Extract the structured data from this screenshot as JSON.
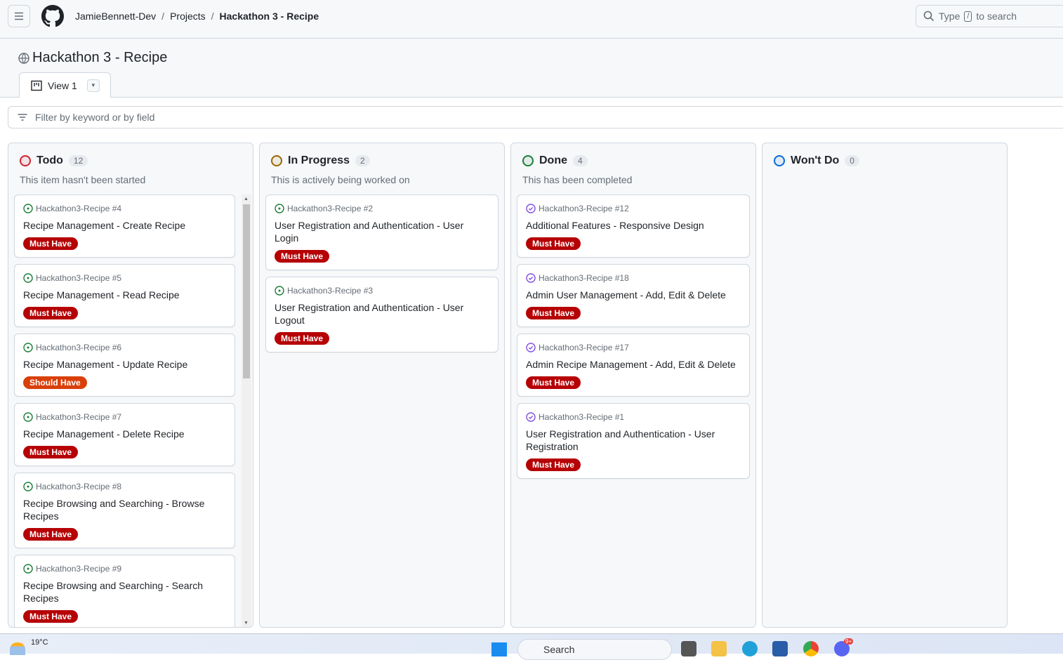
{
  "topbar": {
    "breadcrumb": [
      "JamieBennett-Dev",
      "Projects",
      "Hackathon 3 - Recipe"
    ],
    "search_placeholder_before": "Type",
    "search_key": "/",
    "search_placeholder_after": "to search"
  },
  "project": {
    "title": "Hackathon 3 - Recipe",
    "view_tab": "View 1",
    "filter_placeholder": "Filter by keyword or by field"
  },
  "colors": {
    "must_have": "#b60205",
    "should_have": "#d93f0b",
    "todo": "#cf222e",
    "in_progress": "#9a6700",
    "done": "#1a7f37",
    "wont_do": "#0969da",
    "open_issue": "#1a7f37",
    "closed_issue": "#8250df"
  },
  "columns": [
    {
      "name": "Todo",
      "count": "12",
      "description": "This item hasn't been started",
      "status": "todo",
      "cards": [
        {
          "ref": "Hackathon3-Recipe #4",
          "title": "Recipe Management - Create Recipe",
          "label": "Must Have",
          "state": "open"
        },
        {
          "ref": "Hackathon3-Recipe #5",
          "title": "Recipe Management - Read Recipe",
          "label": "Must Have",
          "state": "open"
        },
        {
          "ref": "Hackathon3-Recipe #6",
          "title": "Recipe Management - Update Recipe",
          "label": "Should Have",
          "state": "open"
        },
        {
          "ref": "Hackathon3-Recipe #7",
          "title": "Recipe Management - Delete Recipe",
          "label": "Must Have",
          "state": "open"
        },
        {
          "ref": "Hackathon3-Recipe #8",
          "title": "Recipe Browsing and Searching - Browse Recipes",
          "label": "Must Have",
          "state": "open"
        },
        {
          "ref": "Hackathon3-Recipe #9",
          "title": "Recipe Browsing and Searching - Search Recipes",
          "label": "Must Have",
          "state": "open"
        }
      ]
    },
    {
      "name": "In Progress",
      "count": "2",
      "description": "This is actively being worked on",
      "status": "in_progress",
      "cards": [
        {
          "ref": "Hackathon3-Recipe #2",
          "title": "User Registration and Authentication - User Login",
          "label": "Must Have",
          "state": "open"
        },
        {
          "ref": "Hackathon3-Recipe #3",
          "title": "User Registration and Authentication - User Logout",
          "label": "Must Have",
          "state": "open"
        }
      ]
    },
    {
      "name": "Done",
      "count": "4",
      "description": "This has been completed",
      "status": "done",
      "cards": [
        {
          "ref": "Hackathon3-Recipe #12",
          "title": "Additional Features - Responsive Design",
          "label": "Must Have",
          "state": "closed"
        },
        {
          "ref": "Hackathon3-Recipe #18",
          "title": "Admin User Management - Add, Edit & Delete",
          "label": "Must Have",
          "state": "closed"
        },
        {
          "ref": "Hackathon3-Recipe #17",
          "title": "Admin Recipe Management - Add, Edit & Delete",
          "label": "Must Have",
          "state": "closed"
        },
        {
          "ref": "Hackathon3-Recipe #1",
          "title": "User Registration and Authentication - User Registration",
          "label": "Must Have",
          "state": "closed"
        }
      ]
    },
    {
      "name": "Won't Do",
      "count": "0",
      "description": "",
      "status": "wont_do",
      "cards": []
    }
  ],
  "taskbar": {
    "temperature": "19°C",
    "search": "Search",
    "notification_badge": "9+"
  }
}
